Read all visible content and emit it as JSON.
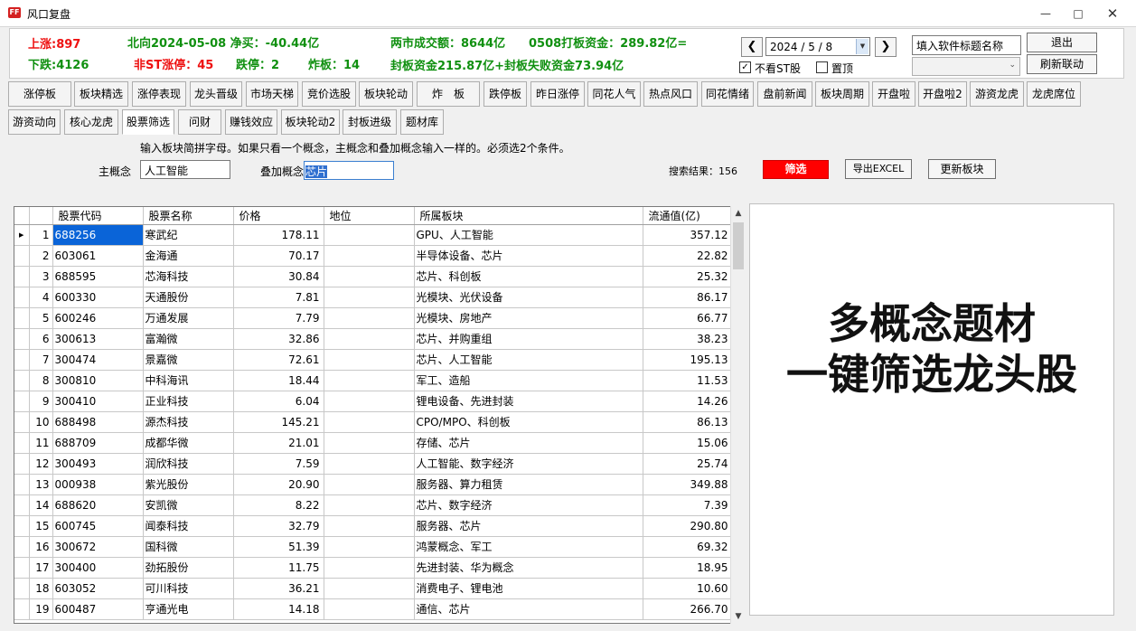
{
  "window": {
    "title": "风口复盘",
    "icon_text": "FF"
  },
  "stats": {
    "up": "上涨:897",
    "down": "下跌:4126",
    "northbound": "北向2024-05-08 净买：-40.44亿",
    "non_st_limit_up": "非ST涨停：45",
    "limit_down": "跌停：2",
    "broken_board": "炸板：14",
    "turnover": "两市成交额：8644亿",
    "sealing_funds": "0508打板资金：289.82亿=",
    "sealing_detail": "封板资金215.87亿+封板失败资金73.94亿"
  },
  "controls": {
    "date": "2024 / 5 / 8",
    "hide_st_label": "不看ST股",
    "hide_st_checked": true,
    "pin_top_label": "置顶",
    "pin_top_checked": false,
    "title_input": "填入软件标题名称",
    "exit_label": "退出",
    "refresh_label": "刷新联动",
    "prev_icon": "chevron-left-icon",
    "next_icon": "chevron-right-icon"
  },
  "tabs_row1": [
    "涨停板",
    "板块精选",
    "涨停表现",
    "龙头晋级",
    "市场天梯",
    "竞价选股",
    "板块轮动",
    "炸　板",
    "跌停板",
    "昨日涨停",
    "同花人气",
    "热点风口",
    "同花情绪",
    "盘前新闻",
    "板块周期",
    "开盘啦",
    "开盘啦2",
    "游资龙虎",
    "龙虎席位"
  ],
  "tabs_row2": [
    "游资动向",
    "核心龙虎",
    "股票筛选",
    "问财",
    "赚钱效应",
    "板块轮动2",
    "封板进级",
    "题材库"
  ],
  "active_tab": "股票筛选",
  "filter": {
    "hint": "输入板块简拼字母。如果只看一个概念，主概念和叠加概念输入一样的。必须选2个条件。",
    "main_label": "主概念",
    "main_value": "人工智能",
    "overlay_label": "叠加概念",
    "overlay_value": "芯片",
    "result_label": "搜索结果：156",
    "filter_button": "筛选",
    "export_button": "导出EXCEL",
    "update_button": "更新板块"
  },
  "table": {
    "columns": [
      "股票代码",
      "股票名称",
      "价格",
      "地位",
      "所属板块",
      "流通值(亿)"
    ],
    "rows": [
      [
        "1",
        "688256",
        "寒武纪",
        "178.11",
        "",
        "GPU、人工智能",
        "357.12"
      ],
      [
        "2",
        "603061",
        "金海通",
        "70.17",
        "",
        "半导体设备、芯片",
        "22.82"
      ],
      [
        "3",
        "688595",
        "芯海科技",
        "30.84",
        "",
        "芯片、科创板",
        "25.32"
      ],
      [
        "4",
        "600330",
        "天通股份",
        "7.81",
        "",
        "光模块、光伏设备",
        "86.17"
      ],
      [
        "5",
        "600246",
        "万通发展",
        "7.79",
        "",
        "光模块、房地产",
        "66.77"
      ],
      [
        "6",
        "300613",
        "富瀚微",
        "32.86",
        "",
        "芯片、并购重组",
        "38.23"
      ],
      [
        "7",
        "300474",
        "景嘉微",
        "72.61",
        "",
        "芯片、人工智能",
        "195.13"
      ],
      [
        "8",
        "300810",
        "中科海讯",
        "18.44",
        "",
        "军工、造船",
        "11.53"
      ],
      [
        "9",
        "300410",
        "正业科技",
        "6.04",
        "",
        "锂电设备、先进封装",
        "14.26"
      ],
      [
        "10",
        "688498",
        "源杰科技",
        "145.21",
        "",
        "CPO/MPO、科创板",
        "86.13"
      ],
      [
        "11",
        "688709",
        "成都华微",
        "21.01",
        "",
        "存储、芯片",
        "15.06"
      ],
      [
        "12",
        "300493",
        "润欣科技",
        "7.59",
        "",
        "人工智能、数字经济",
        "25.74"
      ],
      [
        "13",
        "000938",
        "紫光股份",
        "20.90",
        "",
        "服务器、算力租赁",
        "349.88"
      ],
      [
        "14",
        "688620",
        "安凯微",
        "8.22",
        "",
        "芯片、数字经济",
        "7.39"
      ],
      [
        "15",
        "600745",
        "闻泰科技",
        "32.79",
        "",
        "服务器、芯片",
        "290.80"
      ],
      [
        "16",
        "300672",
        "国科微",
        "51.39",
        "",
        "鸿蒙概念、军工",
        "69.32"
      ],
      [
        "17",
        "300400",
        "劲拓股份",
        "11.75",
        "",
        "先进封装、华为概念",
        "18.95"
      ],
      [
        "18",
        "603052",
        "可川科技",
        "36.21",
        "",
        "消费电子、锂电池",
        "10.60"
      ],
      [
        "19",
        "600487",
        "亨通光电",
        "14.18",
        "",
        "通信、芯片",
        "266.70"
      ]
    ]
  },
  "promo": {
    "line1": "多概念题材",
    "line2": "一键筛选龙头股"
  }
}
